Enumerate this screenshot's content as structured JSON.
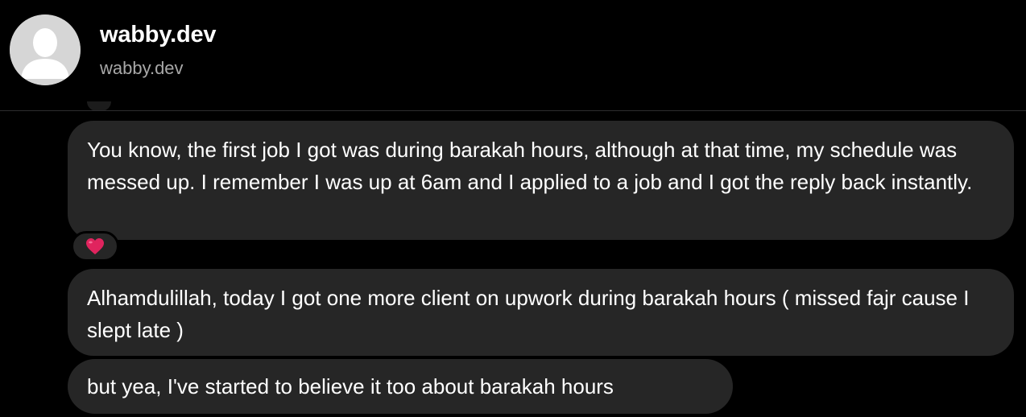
{
  "header": {
    "name": "wabby.dev",
    "handle": "wabby.dev"
  },
  "messages": [
    {
      "text": "You know, the first job I got was during barakah hours, although at that time, my schedule was messed up. I remember I was up at 6am and I applied to a job and I got the reply back instantly.",
      "reaction": "heart"
    },
    {
      "text": "Alhamdulillah, today I got one more client on upwork during barakah hours ( missed fajr cause I slept late )"
    },
    {
      "text": "but yea, I've started to believe it too about barakah hours"
    }
  ],
  "colors": {
    "background": "#000000",
    "bubble": "#262626",
    "handle_text": "#a8a8a8",
    "heart": "#e0245e"
  },
  "icons": {
    "avatar": "default-profile-silhouette-icon",
    "reaction": "red-heart-icon"
  }
}
